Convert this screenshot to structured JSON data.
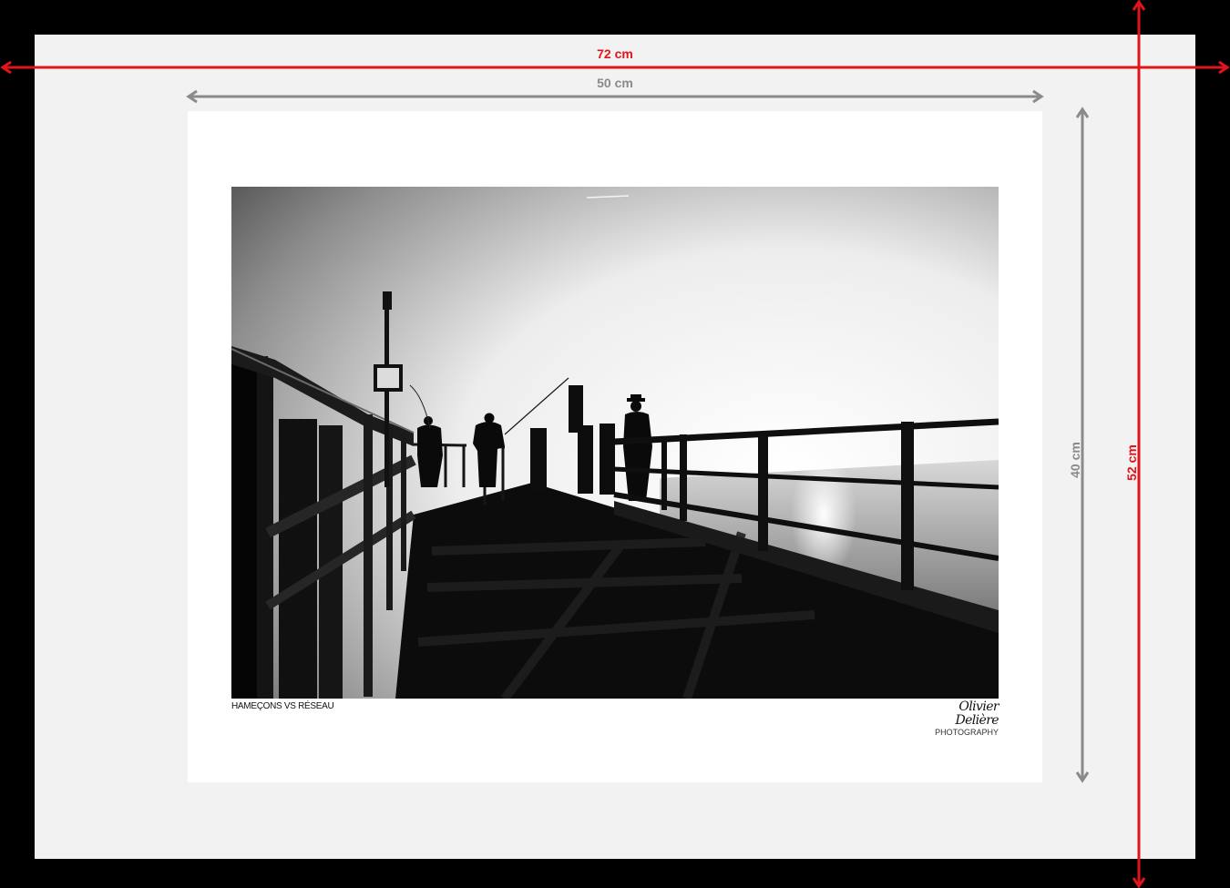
{
  "dimensions": {
    "outer_width": "72 cm",
    "outer_height": "52 cm",
    "inner_width": "50 cm",
    "inner_height": "40 cm"
  },
  "print": {
    "caption": "HAMEÇONS VS RÉSEAU",
    "signature_name": "Olivier Delière",
    "signature_sub": "PHOTOGRAPHY"
  },
  "colors": {
    "outer_dimension": "#e0151b",
    "inner_dimension": "#8a8a8a",
    "background": "#000000",
    "board": "#f2f2f2",
    "paper": "#ffffff"
  }
}
